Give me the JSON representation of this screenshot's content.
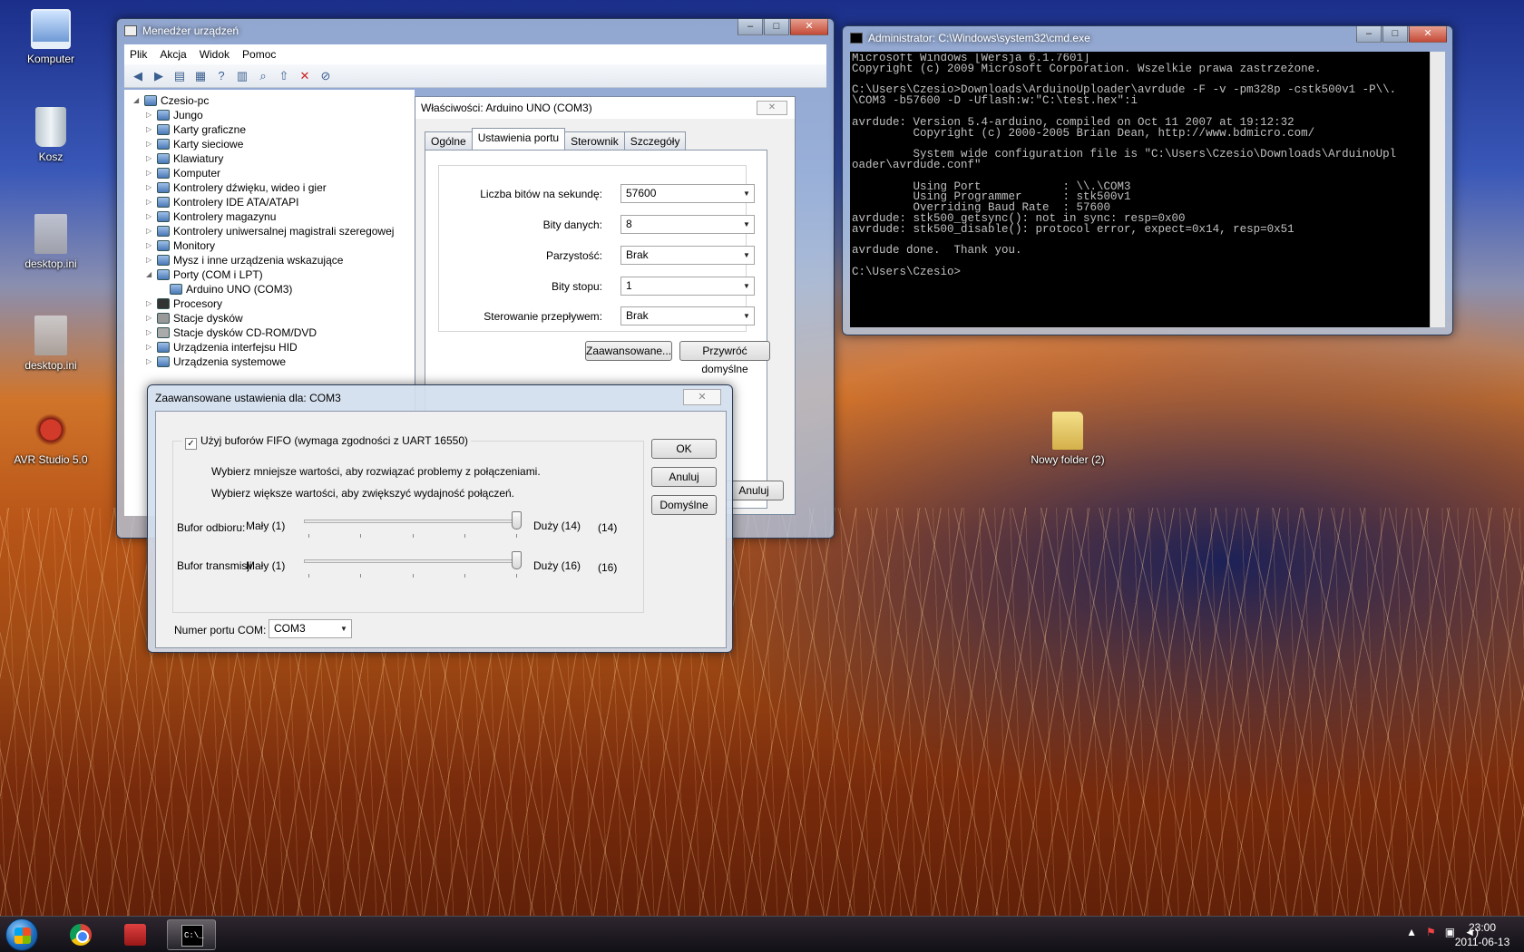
{
  "desktop": {
    "icons": [
      {
        "label": "Komputer",
        "icon": "computer-icon"
      },
      {
        "label": "Kosz",
        "icon": "recycle-bin-icon"
      },
      {
        "label": "desktop.ini",
        "icon": "ini-file-icon"
      },
      {
        "label": "desktop.ini",
        "icon": "ini-file-icon"
      },
      {
        "label": "AVR Studio 5.0",
        "icon": "avr-studio-icon"
      },
      {
        "label": "Nowy folder (2)",
        "icon": "folder-icon"
      }
    ]
  },
  "device_manager": {
    "title": "Menedżer urządzeń",
    "menu": [
      "Plik",
      "Akcja",
      "Widok",
      "Pomoc"
    ],
    "toolbar_icons": [
      "back-icon",
      "forward-icon",
      "view-icon",
      "properties-icon",
      "help-icon",
      "view-details-icon",
      "scan-icon",
      "update-driver-icon",
      "uninstall-icon",
      "disable-icon"
    ],
    "tree": {
      "root": "Czesio-pc",
      "items": [
        "Jungo",
        "Karty graficzne",
        "Karty sieciowe",
        "Klawiatury",
        "Komputer",
        "Kontrolery dźwięku, wideo i gier",
        "Kontrolery IDE ATA/ATAPI",
        "Kontrolery magazynu",
        "Kontrolery uniwersalnej magistrali szeregowej",
        "Monitory",
        "Mysz i inne urządzenia wskazujące",
        "Porty (COM i LPT)",
        "Arduino UNO (COM3)",
        "Procesory",
        "Stacje dysków",
        "Stacje dysków CD-ROM/DVD",
        "Urządzenia interfejsu HID",
        "Urządzenia systemowe"
      ]
    }
  },
  "properties": {
    "title": "Właściwości: Arduino UNO (COM3)",
    "tabs": [
      "Ogólne",
      "Ustawienia portu",
      "Sterownik",
      "Szczegóły"
    ],
    "active_tab": "Ustawienia portu",
    "fields": [
      {
        "label": "Liczba bitów na sekundę:",
        "value": "57600"
      },
      {
        "label": "Bity danych:",
        "value": "8"
      },
      {
        "label": "Parzystość:",
        "value": "Brak"
      },
      {
        "label": "Bity stopu:",
        "value": "1"
      },
      {
        "label": "Sterowanie przepływem:",
        "value": "Brak"
      }
    ],
    "advanced_button": "Zaawansowane...",
    "restore_button": "Przywróć domyślne",
    "cancel_button": "Anuluj"
  },
  "advanced": {
    "title": "Zaawansowane ustawienia dla: COM3",
    "fifo_label": "Użyj buforów FIFO (wymaga zgodności z UART 16550)",
    "fifo_checked": true,
    "hint1": "Wybierz mniejsze wartości, aby rozwiązać problemy z połączeniami.",
    "hint2": "Wybierz większe wartości, aby zwiększyć wydajność połączeń.",
    "receive": {
      "label": "Bufor odbioru:",
      "min_label": "Mały (1)",
      "max_label": "Duży (14)",
      "value": "(14)",
      "min": 1,
      "max": 14,
      "current": 14
    },
    "transmit": {
      "label": "Bufor transmisji:",
      "min_label": "Mały (1)",
      "max_label": "Duży (16)",
      "value": "(16)",
      "min": 1,
      "max": 16,
      "current": 16
    },
    "com_label": "Numer portu COM:",
    "com_value": "COM3",
    "ok": "OK",
    "cancel": "Anuluj",
    "defaults": "Domyślne"
  },
  "cmd": {
    "title": "Administrator: C:\\Windows\\system32\\cmd.exe",
    "lines": [
      "Microsoft Windows [Wersja 6.1.7601]",
      "Copyright (c) 2009 Microsoft Corporation. Wszelkie prawa zastrzeżone.",
      "",
      "C:\\Users\\Czesio>Downloads\\ArduinoUploader\\avrdude -F -v -pm328p -cstk500v1 -P\\\\.",
      "\\COM3 -b57600 -D -Uflash:w:\"C:\\test.hex\":i",
      "",
      "avrdude: Version 5.4-arduino, compiled on Oct 11 2007 at 19:12:32",
      "         Copyright (c) 2000-2005 Brian Dean, http://www.bdmicro.com/",
      "",
      "         System wide configuration file is \"C:\\Users\\Czesio\\Downloads\\ArduinoUpl",
      "oader\\avrdude.conf\"",
      "",
      "         Using Port            : \\\\.\\COM3",
      "         Using Programmer      : stk500v1",
      "         Overriding Baud Rate  : 57600",
      "avrdude: stk500_getsync(): not in sync: resp=0x00",
      "avrdude: stk500_disable(): protocol error, expect=0x14, resp=0x51",
      "",
      "avrdude done.  Thank you.",
      "",
      "C:\\Users\\Czesio>"
    ]
  },
  "taskbar": {
    "apps": [
      "chrome-icon",
      "toolbox-icon",
      "cmd-icon"
    ],
    "tray_icons": [
      "show-hidden-icon",
      "action-center-icon",
      "network-icon",
      "volume-icon"
    ],
    "time": "23:00",
    "date": "2011-06-13"
  }
}
